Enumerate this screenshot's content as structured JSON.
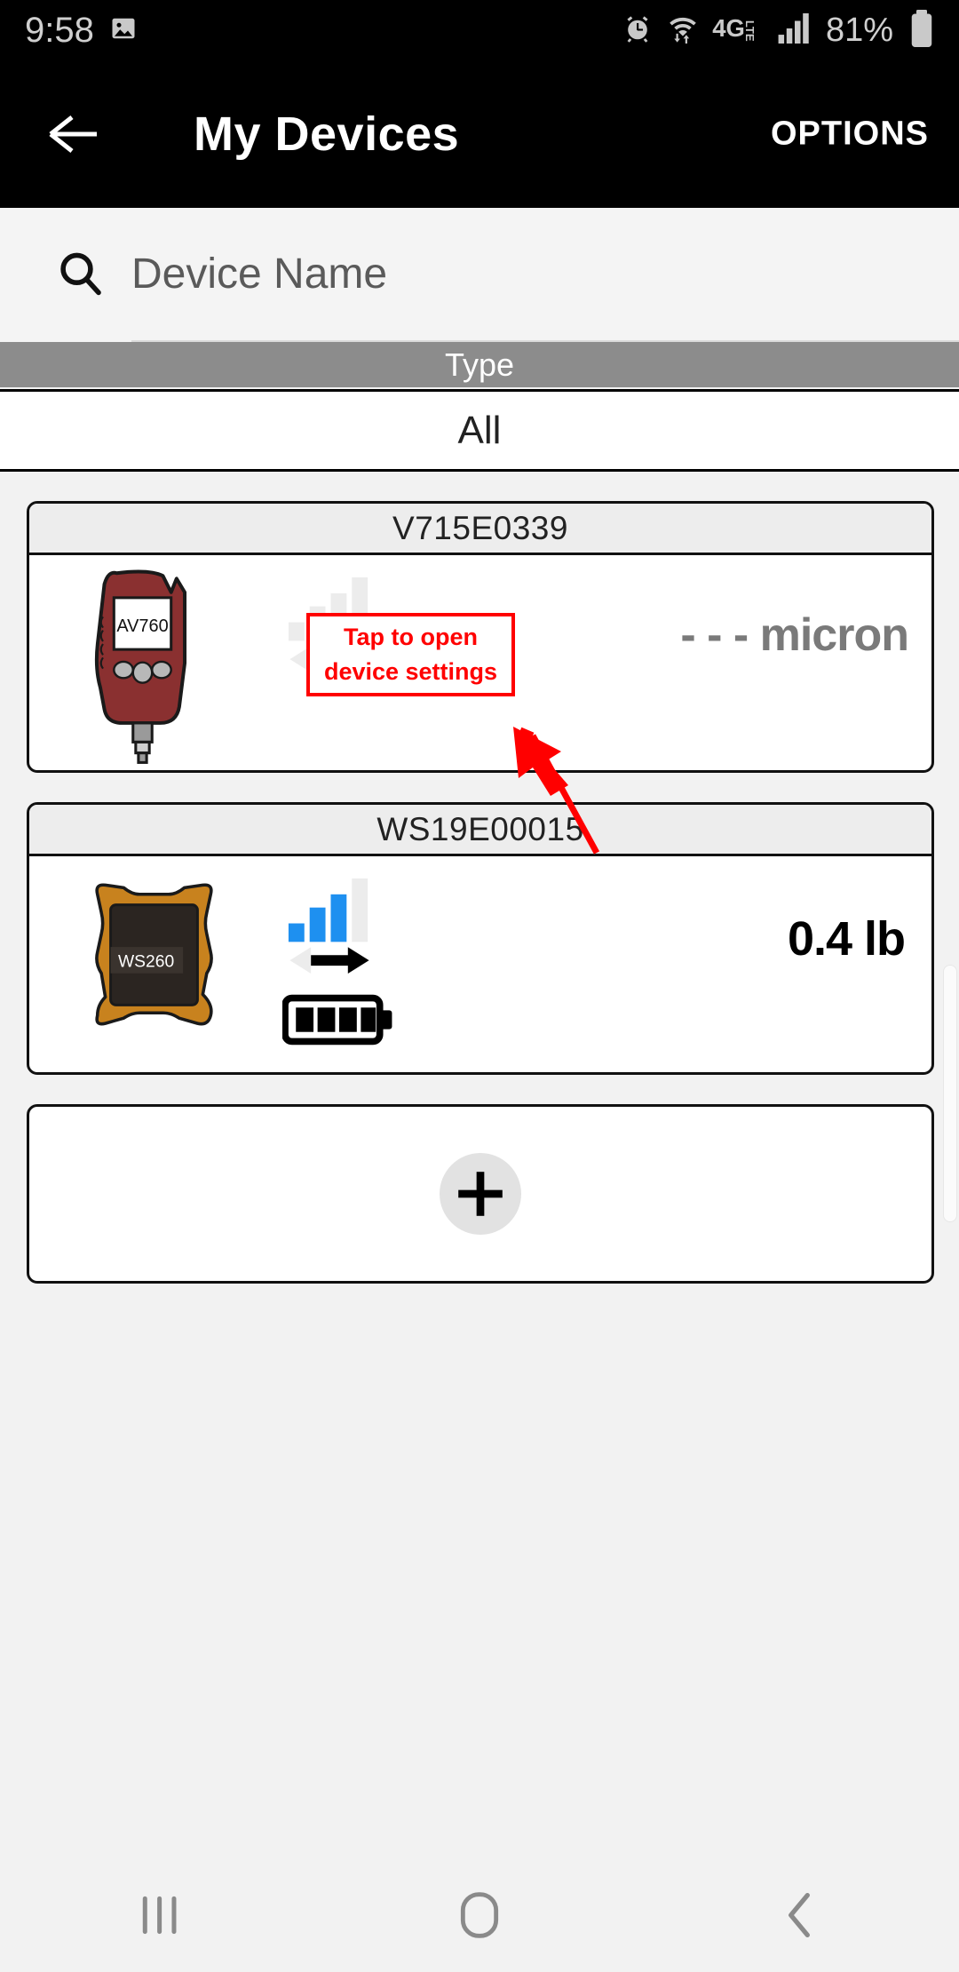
{
  "status_bar": {
    "time": "9:58",
    "battery_percent": "81%",
    "network": "4G",
    "network_sub": "LTE",
    "icons": [
      "image-icon",
      "alarm-icon",
      "wifi-icon",
      "4glte-icon",
      "signal-icon",
      "battery-icon"
    ]
  },
  "app_bar": {
    "back_label": "back-arrow",
    "title": "My Devices",
    "options_label": "OPTIONS"
  },
  "search": {
    "placeholder": "Device Name",
    "value": ""
  },
  "filter": {
    "header": "Type",
    "selected": "All",
    "options": [
      "All"
    ]
  },
  "devices": [
    {
      "serial": "V715E0339",
      "model": "AV760",
      "device_color": "#8a3030",
      "signal_bars_active": 0,
      "signal_bars_total": 4,
      "signal_color_active": "#d8d8d8",
      "signal_color_inactive": "#ececec",
      "transfer_direction": "both-inactive",
      "battery_shown": false,
      "reading": "- - - micron",
      "reading_color": "#7a7a7a"
    },
    {
      "serial": "WS19E00015",
      "model": "WS260",
      "device_color": "#c8821e",
      "signal_bars_active": 3,
      "signal_bars_total": 4,
      "signal_color_active": "#1e90f0",
      "signal_color_inactive": "#ececec",
      "transfer_direction": "right-active",
      "battery_shown": true,
      "battery_segments": 4,
      "reading": "0.4 lb",
      "reading_color": "#000000"
    }
  ],
  "add_device": {
    "label": "+",
    "name": "add-device-button"
  },
  "annotation": {
    "line1": "Tap to open",
    "line2": "device settings",
    "color": "#ff0000"
  },
  "nav_bar": {
    "recents": "recents-icon",
    "home": "home-icon",
    "back": "back-icon"
  },
  "colors": {
    "page_bg": "#f2f2f2",
    "bar_bg": "#000000",
    "type_header": "#8c8c8c",
    "card_border": "#111111",
    "accent_blue": "#1e90f0",
    "annotation_red": "#ff0000"
  }
}
